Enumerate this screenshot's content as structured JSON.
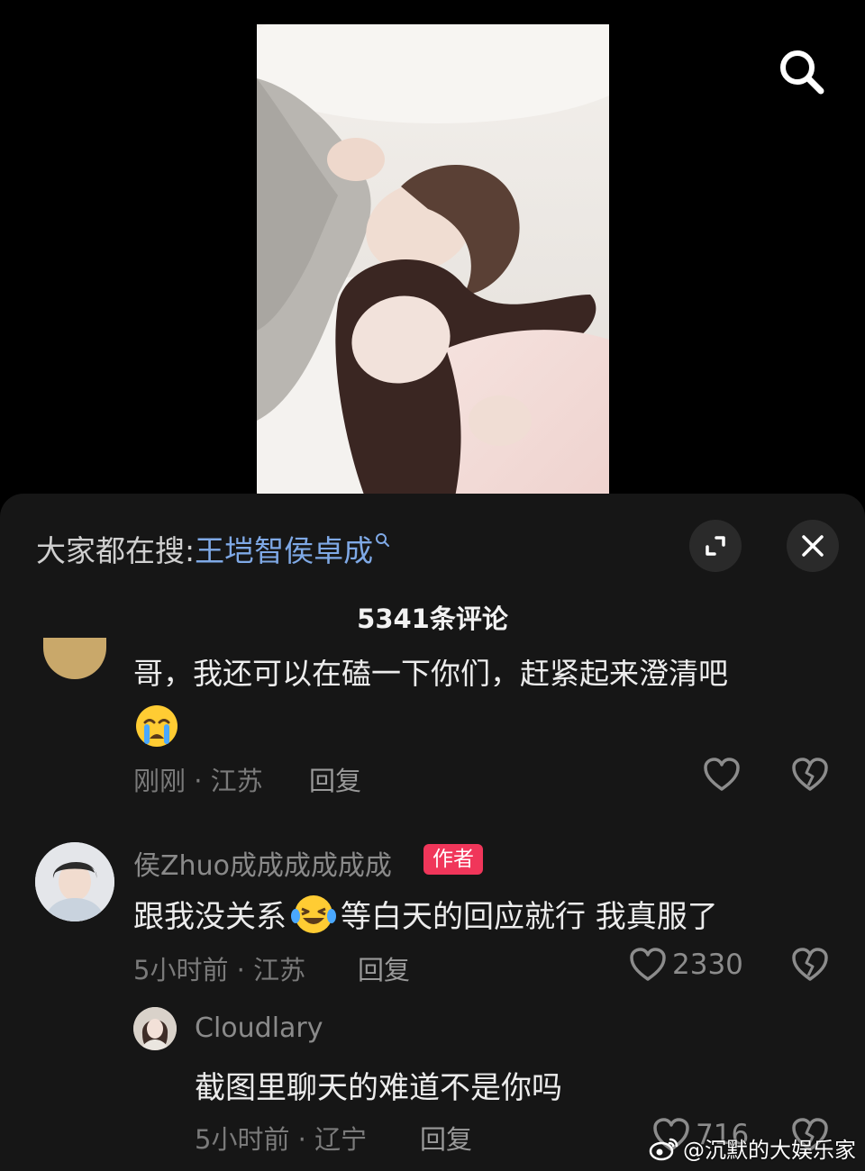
{
  "sheet": {
    "suggest_prefix": "大家都在搜:",
    "suggest_term": "王垲智侯卓成",
    "comment_count": "5341条评论"
  },
  "comments": [
    {
      "text_line1": "哥，我还可以在磕一下你们，赶紧起来澄清吧",
      "time_location": "刚刚 · 江苏",
      "reply_label": "回复"
    },
    {
      "username": "侯Zhuo成成成成成成",
      "badge": "作者",
      "text_before_emoji": "跟我没关系",
      "text_after_emoji": "等白天的回应就行 我真服了",
      "time_location": "5小时前 · 江苏",
      "reply_label": "回复",
      "likes": "2330"
    },
    {
      "username": "Cloudlary",
      "text": "截图里聊天的难道不是你吗",
      "time_location": "5小时前 · 辽宁",
      "reply_label": "回复",
      "likes": "716"
    }
  ],
  "watermark": "@沉默的大娱乐家",
  "icons": [
    "search-icon",
    "expand-icon",
    "close-icon",
    "heart-icon",
    "broken-heart-icon",
    "weibo-logo-icon"
  ],
  "colors": {
    "background": "#000000",
    "sheet": "#161616",
    "link": "#7fa9e6",
    "badge": "#f0365a"
  }
}
